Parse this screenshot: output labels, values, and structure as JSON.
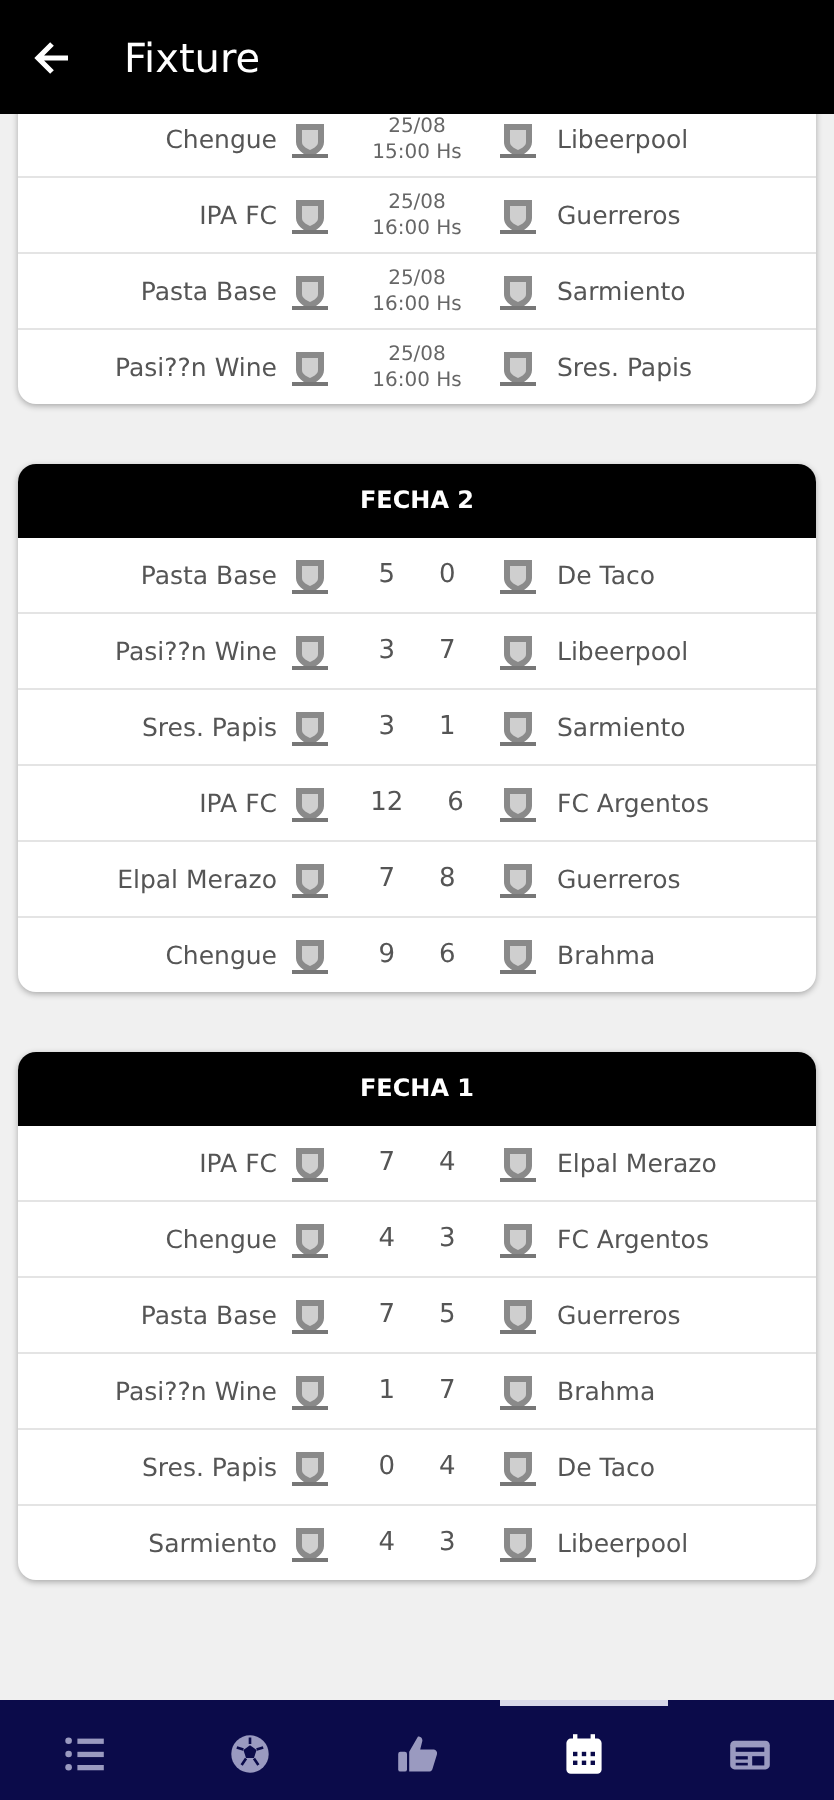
{
  "header": {
    "title": "Fixture"
  },
  "rounds": [
    {
      "matches": [
        {
          "kind": "scheduled",
          "home": "Chengue",
          "away": "Libeerpool",
          "date": "25/08",
          "time": "15:00 Hs"
        },
        {
          "kind": "scheduled",
          "home": "IPA FC",
          "away": "Guerreros",
          "date": "25/08",
          "time": "16:00 Hs"
        },
        {
          "kind": "scheduled",
          "home": "Pasta Base",
          "away": "Sarmiento",
          "date": "25/08",
          "time": "16:00 Hs"
        },
        {
          "kind": "scheduled",
          "home": "Pasi??n Wine",
          "away": "Sres. Papis",
          "date": "25/08",
          "time": "16:00 Hs"
        }
      ]
    },
    {
      "title": "FECHA 2",
      "matches": [
        {
          "kind": "played",
          "home": "Pasta Base",
          "away": "De Taco",
          "home_score": "5",
          "away_score": "0"
        },
        {
          "kind": "played",
          "home": "Pasi??n Wine",
          "away": "Libeerpool",
          "home_score": "3",
          "away_score": "7"
        },
        {
          "kind": "played",
          "home": "Sres. Papis",
          "away": "Sarmiento",
          "home_score": "3",
          "away_score": "1"
        },
        {
          "kind": "played",
          "home": "IPA FC",
          "away": "FC Argentos",
          "home_score": "12",
          "away_score": "6"
        },
        {
          "kind": "played",
          "home": "Elpal Merazo",
          "away": "Guerreros",
          "home_score": "7",
          "away_score": "8"
        },
        {
          "kind": "played",
          "home": "Chengue",
          "away": "Brahma",
          "home_score": "9",
          "away_score": "6"
        }
      ]
    },
    {
      "title": "FECHA 1",
      "matches": [
        {
          "kind": "played",
          "home": "IPA FC",
          "away": "Elpal Merazo",
          "home_score": "7",
          "away_score": "4"
        },
        {
          "kind": "played",
          "home": "Chengue",
          "away": "FC Argentos",
          "home_score": "4",
          "away_score": "3"
        },
        {
          "kind": "played",
          "home": "Pasta Base",
          "away": "Guerreros",
          "home_score": "7",
          "away_score": "5"
        },
        {
          "kind": "played",
          "home": "Pasi??n Wine",
          "away": "Brahma",
          "home_score": "1",
          "away_score": "7"
        },
        {
          "kind": "played",
          "home": "Sres. Papis",
          "away": "De Taco",
          "home_score": "0",
          "away_score": "4"
        },
        {
          "kind": "played",
          "home": "Sarmiento",
          "away": "Libeerpool",
          "home_score": "4",
          "away_score": "3"
        }
      ]
    }
  ],
  "bottom_nav": [
    {
      "kind": "list",
      "selected": false
    },
    {
      "kind": "ball",
      "selected": false
    },
    {
      "kind": "thumbs",
      "selected": false
    },
    {
      "kind": "calendar",
      "selected": true
    },
    {
      "kind": "newspaper",
      "selected": false
    }
  ]
}
